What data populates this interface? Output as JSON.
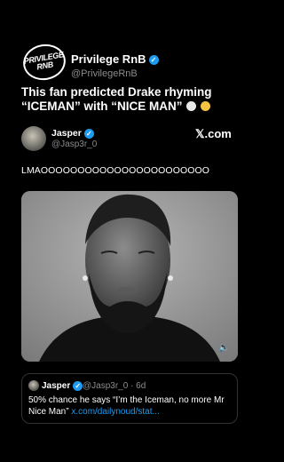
{
  "account": {
    "logo_line1": "PRIVILEGE",
    "logo_line2": "RNB",
    "name": "Privilege RnB",
    "handle": "@PrivilegeRnB",
    "verified_icon": "✓"
  },
  "headline": {
    "line1": "This fan predicted Drake rhyming",
    "line2": "“ICEMAN” with “NICE MAN”"
  },
  "tweet": {
    "name": "Jasper",
    "handle": "@Jasp3r_0",
    "brand": "𝕏.com",
    "text": "LMAOOOOOOOOOOOOOOOOOOOOOOO",
    "speaker_icon": "🔈"
  },
  "quote": {
    "name": "Jasper",
    "handle_time": "@Jasp3r_0 · 6d",
    "text": "50% chance he says “I’m the Iceman, no more Mr Nice Man”",
    "link": "x.com/dailynoud/stat..."
  },
  "colors": {
    "accent": "#1d9bf0",
    "muted": "#8b8b8b"
  }
}
